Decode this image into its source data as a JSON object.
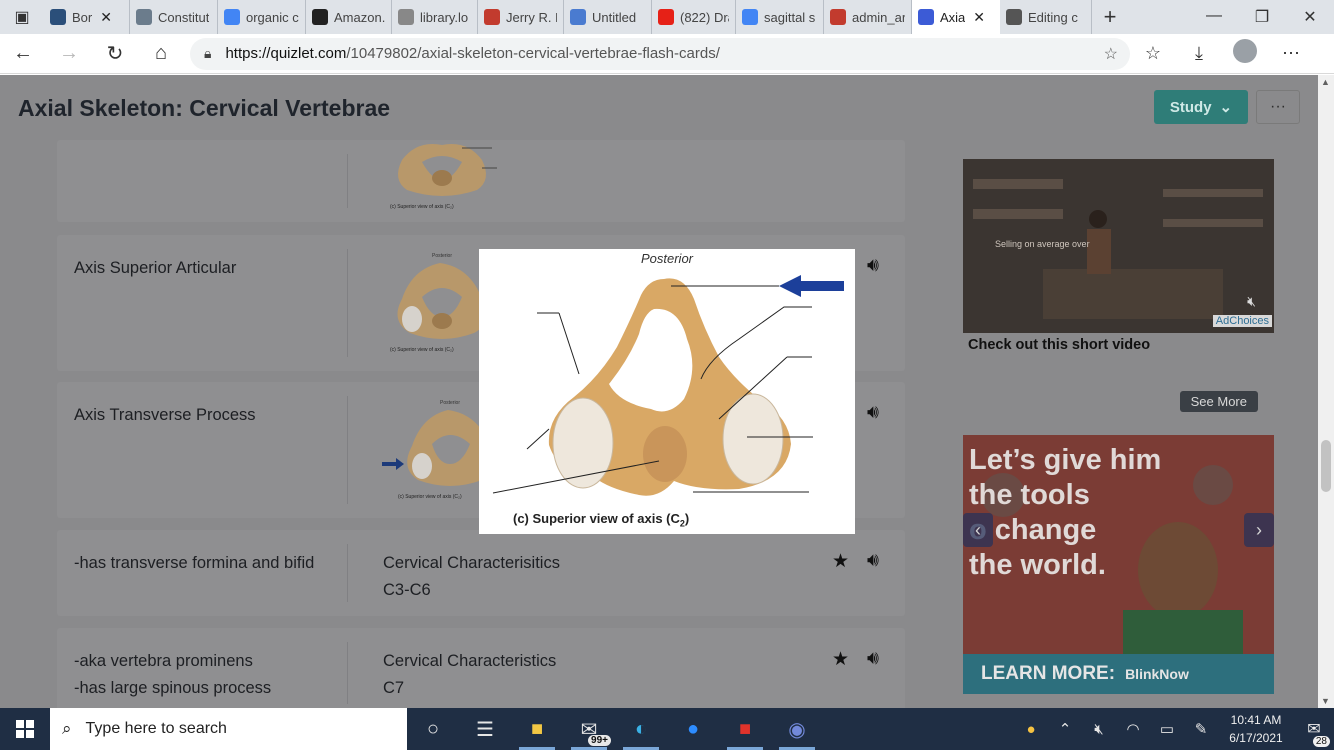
{
  "browser": {
    "tabs": [
      {
        "label": "Bor",
        "icon": "wiki-icon",
        "color": "#2b4f7a"
      },
      {
        "label": "Constitut",
        "icon": "page-icon",
        "color": "#6b7c8c"
      },
      {
        "label": "organic c",
        "icon": "google-icon",
        "color": "#4285f4"
      },
      {
        "label": "Amazon.",
        "icon": "amazon-icon",
        "color": "#222222"
      },
      {
        "label": "library.lo",
        "icon": "doc-icon",
        "color": "#888888"
      },
      {
        "label": "Jerry R. N",
        "icon": "pdf-icon",
        "color": "#c23b2e"
      },
      {
        "label": "Untitled",
        "icon": "gdoc-icon",
        "color": "#4a7bd0"
      },
      {
        "label": "(822) Dra",
        "icon": "youtube-icon",
        "color": "#e62117"
      },
      {
        "label": "sagittal s",
        "icon": "google-icon",
        "color": "#4285f4"
      },
      {
        "label": "admin_ar",
        "icon": "pdf-icon",
        "color": "#c23b2e"
      },
      {
        "label": "Axia",
        "icon": "quizlet-icon",
        "color": "#3c5bd6",
        "active": true
      },
      {
        "label": "Editing c",
        "icon": "quiz-bot-icon",
        "color": "#555555"
      }
    ],
    "url_host": "https://quizlet.com",
    "url_path": "/10479802/axial-skeleton-cervical-vertebrae-flash-cards/"
  },
  "page": {
    "set_title": "Axial Skeleton: Cervical Vertebrae",
    "study_label": "Study",
    "more_label": "···"
  },
  "cards": [
    {
      "term": "",
      "definition": "",
      "has_image": true,
      "thumb_caption": "(c) Superior view of axis (C₂)"
    },
    {
      "term": "Axis Superior Articular",
      "definition": "",
      "has_image": true,
      "thumb_label": "Posterior",
      "thumb_caption": "(c) Superior view of axis (C₂)"
    },
    {
      "term": "Axis Transverse Process",
      "definition": "",
      "has_image": true,
      "thumb_label": "Posterior",
      "thumb_caption": "(c) Superior view of axis (C₂)"
    },
    {
      "term": "-has transverse formina and bifid",
      "definition_line1": "Cervical Characterisitics",
      "definition_line2": "C3-C6"
    },
    {
      "term_line1": "-aka vertebra prominens",
      "term_line2": "-has large spinous process",
      "definition_line1": "Cervical Characteristics",
      "definition_line2": "C7"
    }
  ],
  "overlay": {
    "top_label": "Posterior",
    "caption": "(c) Superior view of axis (C",
    "caption_sub": "2",
    "caption_end": ")"
  },
  "ads": {
    "video_overlay_text": "Selling on average over",
    "adchoices": "AdChoices",
    "headline": "Check out this short video",
    "see_more": "See More",
    "banner_slogan": [
      "Let’s give him",
      "the tools",
      "o change",
      "the world."
    ],
    "banner_cta": "LEARN MORE:",
    "banner_brand": "BlinkNow"
  },
  "taskbar": {
    "search_placeholder": "Type here to search",
    "mail_badge": "99+",
    "time": "10:41 AM",
    "date": "6/17/2021",
    "notifications": "28"
  }
}
